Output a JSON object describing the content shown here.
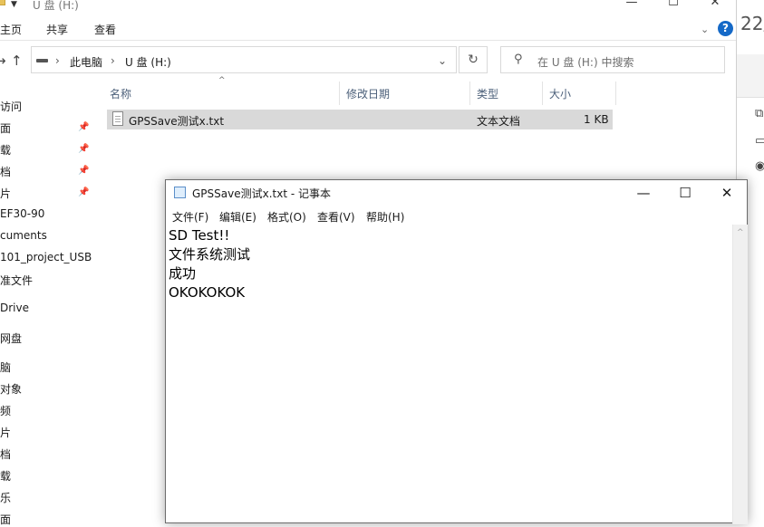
{
  "explorer": {
    "title": "U 盘 (H:)",
    "window_controls": {
      "minimize": "—",
      "maximize": "☐",
      "close": "✕"
    },
    "ribbon": {
      "tabs": [
        "主页",
        "共享",
        "查看"
      ],
      "expand": "⌄",
      "help": "?"
    },
    "address": {
      "segments": [
        "此电脑",
        "U 盘 (H:)"
      ],
      "separator": "›",
      "dropdown": "⌄",
      "refresh": "↻"
    },
    "search": {
      "placeholder": "在 U 盘 (H:) 中搜索"
    },
    "nav": {
      "back": "←",
      "forward": "→",
      "up": "↑"
    },
    "sidebar": {
      "items": [
        "访问",
        "面",
        "载",
        "档",
        "片",
        "EF30-90",
        "cuments",
        "101_project_USB",
        "准文件",
        "Drive",
        "网盘",
        "脑",
        "对象",
        "频",
        "片",
        "档",
        "载",
        "乐",
        "面"
      ]
    },
    "columns": [
      "名称",
      "修改日期",
      "类型",
      "大小"
    ],
    "files": [
      {
        "name": "GPSSave测试x.txt",
        "modified": "",
        "type": "文本文档",
        "size": "1 KB"
      }
    ]
  },
  "background_window": {
    "date_fragment": "22/"
  },
  "notepad": {
    "title": "GPSSave测试x.txt - 记事本",
    "window_controls": {
      "minimize": "—",
      "maximize": "☐",
      "close": "✕"
    },
    "menu": [
      "文件(F)",
      "编辑(E)",
      "格式(O)",
      "查看(V)",
      "帮助(H)"
    ],
    "content_lines": [
      "SD Test!!",
      "文件系统测试",
      "成功",
      "OKOKOKOK"
    ]
  }
}
